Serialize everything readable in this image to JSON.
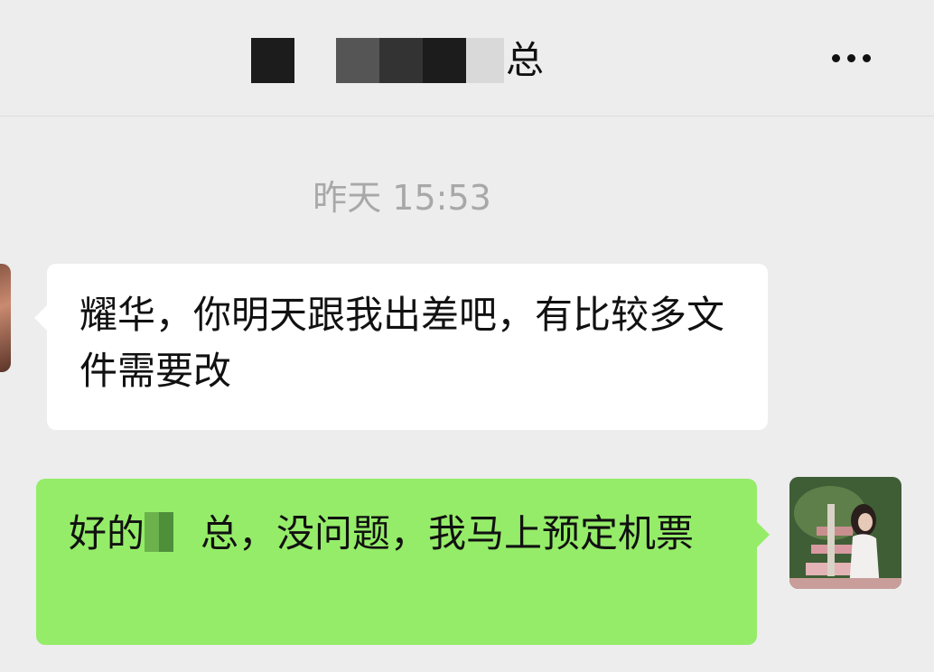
{
  "header": {
    "title_suffix": "总",
    "menu_icon": "more-dots-icon"
  },
  "chat": {
    "timestamp": "昨天 15:53",
    "messages": [
      {
        "direction": "incoming",
        "text": "耀华，你明天跟我出差吧，有比较多文件需要改"
      },
      {
        "direction": "outgoing",
        "text_before": "好的",
        "text_after": "总，没问题，我马上预定机票"
      }
    ]
  },
  "colors": {
    "background": "#ededed",
    "incoming_bubble": "#ffffff",
    "outgoing_bubble": "#95ec69",
    "timestamp_text": "#a8a8a8"
  }
}
